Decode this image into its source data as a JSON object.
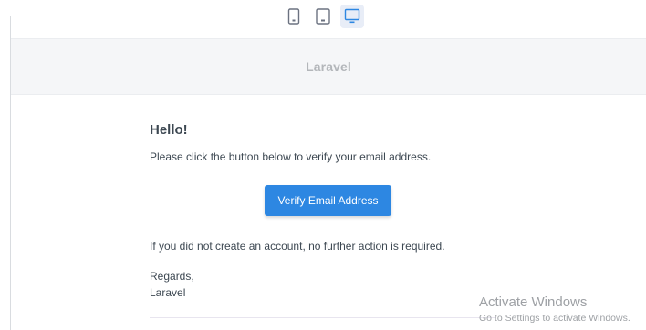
{
  "toolbar": {
    "devices": [
      {
        "icon": "phone-icon",
        "active": false
      },
      {
        "icon": "tablet-icon",
        "active": false
      },
      {
        "icon": "desktop-icon",
        "active": true
      }
    ],
    "active_color": "#2d87e2",
    "inactive_color": "#6b7280"
  },
  "email": {
    "header": {
      "brand": "Laravel"
    },
    "greeting": "Hello!",
    "intro_line": "Please click the button below to verify your email address.",
    "action_button": {
      "label": "Verify Email Address",
      "color": "#2d87e2"
    },
    "outro_line": "If you did not create an account, no further action is required.",
    "salutation": "Regards,",
    "signature": "Laravel"
  },
  "watermark": {
    "title": "Activate Windows",
    "subtitle": "Go to Settings to activate Windows."
  }
}
